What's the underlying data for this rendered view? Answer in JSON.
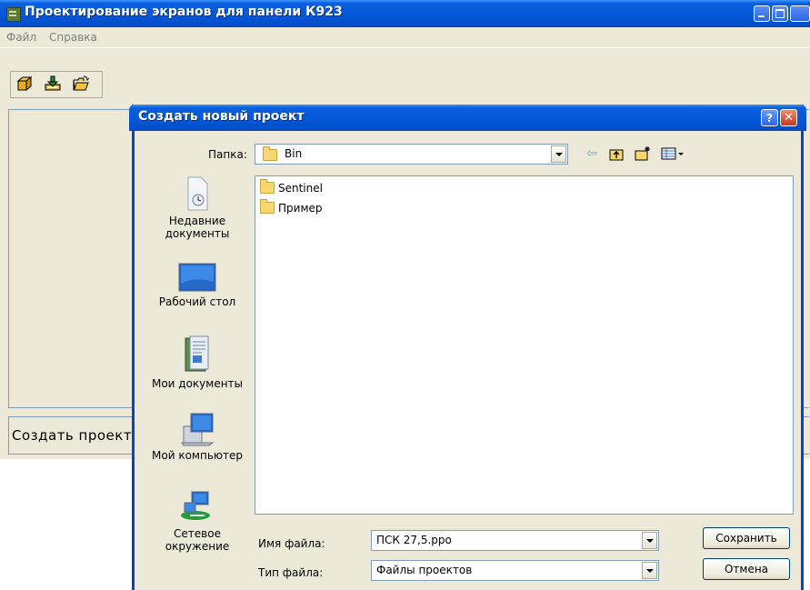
{
  "app": {
    "title": "Проектирование экранов для панели К923",
    "menu": [
      "Файл",
      "Справка"
    ],
    "status_text": "Создать проект"
  },
  "toolbar": {
    "icons": [
      "new-project-icon",
      "save-project-icon",
      "open-project-icon"
    ]
  },
  "dialog": {
    "title": "Создать новый проект",
    "help_label": "?",
    "close_label": "✕",
    "folder_label": "Папка:",
    "folder_value": "Bin",
    "places": [
      {
        "label": "Недавние документы",
        "icon": "recent-documents-icon"
      },
      {
        "label": "Рабочий стол",
        "icon": "desktop-icon"
      },
      {
        "label": "Мои документы",
        "icon": "my-documents-icon"
      },
      {
        "label": "Мой компьютер",
        "icon": "my-computer-icon"
      },
      {
        "label": "Сетевое окружение",
        "icon": "network-places-icon"
      }
    ],
    "files": [
      "Sentinel",
      "Пример"
    ],
    "filename_label": "Имя файла:",
    "filename_value": "ПСК 27,5.ppo",
    "filetype_label": "Тип файла:",
    "filetype_value": "Файлы проектов",
    "save_label": "Сохранить",
    "cancel_label": "Отмена"
  },
  "colors": {
    "titlebar": "#0558d8",
    "window_bg": "#ece9d8",
    "border": "#7f9db9"
  }
}
